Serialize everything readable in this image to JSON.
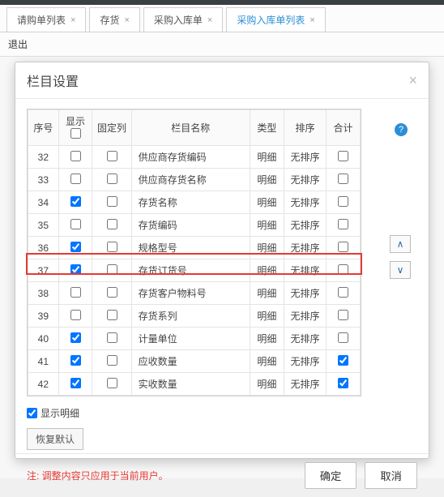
{
  "tabs": [
    {
      "label": "请购单列表",
      "active": false
    },
    {
      "label": "存货",
      "active": false
    },
    {
      "label": "采购入库单",
      "active": false
    },
    {
      "label": "采购入库单列表",
      "active": true
    }
  ],
  "exit_label": "退出",
  "dialog": {
    "title": "栏目设置",
    "help": "?",
    "columns": {
      "seq": "序号",
      "show": "显示",
      "fixed": "固定列",
      "name": "栏目名称",
      "type": "类型",
      "sort": "排序",
      "sum": "合计"
    },
    "rows": [
      {
        "seq": "32",
        "show": false,
        "fixed": false,
        "name": "供应商存货编码",
        "type": "明细",
        "sort": "无排序",
        "sum": false,
        "hl": false
      },
      {
        "seq": "33",
        "show": false,
        "fixed": false,
        "name": "供应商存货名称",
        "type": "明细",
        "sort": "无排序",
        "sum": false,
        "hl": false
      },
      {
        "seq": "34",
        "show": true,
        "fixed": false,
        "name": "存货名称",
        "type": "明细",
        "sort": "无排序",
        "sum": false,
        "hl": false
      },
      {
        "seq": "35",
        "show": false,
        "fixed": false,
        "name": "存货编码",
        "type": "明细",
        "sort": "无排序",
        "sum": false,
        "hl": false
      },
      {
        "seq": "36",
        "show": true,
        "fixed": false,
        "name": "规格型号",
        "type": "明细",
        "sort": "无排序",
        "sum": false,
        "hl": false
      },
      {
        "seq": "37",
        "show": true,
        "fixed": false,
        "name": "存货订货号",
        "type": "明细",
        "sort": "无排序",
        "sum": false,
        "hl": true
      },
      {
        "seq": "38",
        "show": false,
        "fixed": false,
        "name": "存货客户物料号",
        "type": "明细",
        "sort": "无排序",
        "sum": false,
        "hl": false
      },
      {
        "seq": "39",
        "show": false,
        "fixed": false,
        "name": "存货系列",
        "type": "明细",
        "sort": "无排序",
        "sum": false,
        "hl": false
      },
      {
        "seq": "40",
        "show": true,
        "fixed": false,
        "name": "计量单位",
        "type": "明细",
        "sort": "无排序",
        "sum": false,
        "hl": false
      },
      {
        "seq": "41",
        "show": true,
        "fixed": false,
        "name": "应收数量",
        "type": "明细",
        "sort": "无排序",
        "sum": true,
        "hl": false
      },
      {
        "seq": "42",
        "show": true,
        "fixed": false,
        "name": "实收数量",
        "type": "明细",
        "sort": "无排序",
        "sum": true,
        "hl": false
      }
    ],
    "show_detail_label": "显示明细",
    "show_detail_checked": true,
    "restore_label": "恢复默认",
    "footer_note": "注: 调整内容只应用于当前用户。",
    "ok_label": "确定",
    "cancel_label": "取消",
    "arrow_up": "∧",
    "arrow_down": "∨"
  }
}
